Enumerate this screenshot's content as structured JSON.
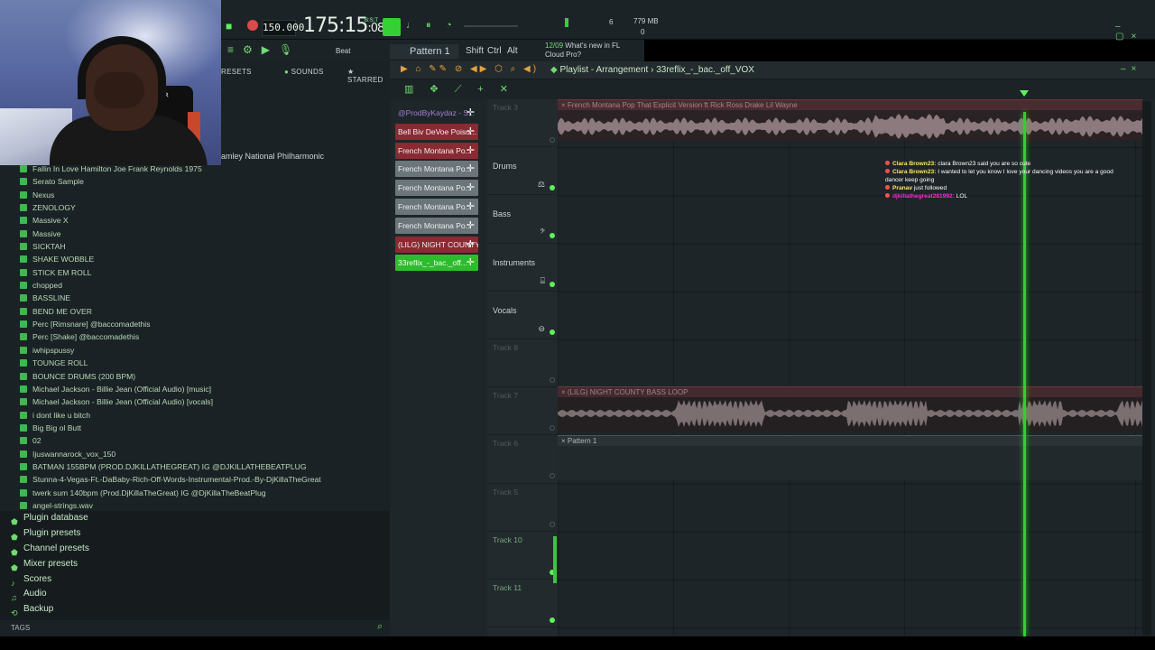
{
  "toolbar": {
    "tempo": "150.000",
    "time": "175:15",
    "time_small": ":08",
    "time_sup": "B:S:T",
    "cpu_num": "6",
    "ram": "779 MB",
    "poly": "0",
    "pattern": "Pattern 1",
    "shift": "Shift",
    "ctrl": "Ctrl",
    "alt": "Alt",
    "beat": "Beat",
    "news_date": "12/09",
    "news_text": "What's new in FL",
    "news_text2": "Cloud Pro?"
  },
  "webcam": {
    "chair_logo": "BOSS R"
  },
  "browser": {
    "tabs": [
      "RESETS",
      "SOUNDS",
      "STARRED"
    ],
    "header_item": "amley National Philharmonic",
    "items": [
      "Fallin In Love  Hamilton Joe Frank  Reynolds  1975",
      "Serato Sample",
      "Nexus",
      "ZENOLOGY",
      "Massive X",
      "Massive",
      "SICKTAH",
      "SHAKE WOBBLE",
      "STICK EM ROLL",
      "chopped",
      "BASSLINE",
      "BEND ME OVER",
      "Perc [Rimsnare] @baccomadethis",
      "Perc [Shake] @baccomadethis",
      "iwhipspussy",
      "TOUNGE ROLL",
      "BOUNCE DRUMS (200 BPM)",
      "Michael Jackson - Billie Jean (Official Audio) [music]",
      "Michael Jackson - Billie Jean (Official Audio) [vocals]",
      "i dont like u bitch",
      "Big Big ol Butt",
      "02",
      "Ijuswannarock_vox_150",
      "BATMAN 155BPM (PROD.DJKILLATHEGREAT) IG @DJKILLATHEBEATPLUG",
      "Stunna-4-Vegas-Ft.-DaBaby-Rich-Off-Words-Instrumental-Prod.-By-DjKillaTheGreat",
      "twerk sum 140bpm (Prod.DjKillaTheGreat) IG @DjKillaTheBeatPlug",
      "angel-strings.wav"
    ],
    "folders": [
      {
        "label": "Plugin database",
        "icon": "plug-icon"
      },
      {
        "label": "Plugin presets",
        "icon": "plug-icon"
      },
      {
        "label": "Channel presets",
        "icon": "plug-icon"
      },
      {
        "label": "Mixer presets",
        "icon": "plug-icon"
      },
      {
        "label": "Scores",
        "icon": "note-icon"
      },
      {
        "label": "Audio",
        "icon": "audio-icon"
      },
      {
        "label": "Backup",
        "icon": "backup-icon"
      }
    ],
    "tags_label": "TAGS"
  },
  "playlist": {
    "title": "Playlist - Arrangement",
    "title_sep": "›",
    "file": "33reflix_-_bac._off_VOX",
    "picker": [
      {
        "label": "@ProdByKaydaz - S...",
        "style": "header"
      },
      {
        "label": "Bell Biv DeVoe  Poiso...",
        "style": "red"
      },
      {
        "label": "French Montana  Po...",
        "style": "red"
      },
      {
        "label": "French Montana  Po...",
        "style": "gray"
      },
      {
        "label": "French Montana  Po...",
        "style": "gray"
      },
      {
        "label": "French Montana  Po...",
        "style": "gray"
      },
      {
        "label": "French Montana  Po...",
        "style": "gray"
      },
      {
        "label": "(LILG) NIGHT COUNTY...",
        "style": "red"
      },
      {
        "label": "33reflix_-_bac._off...",
        "style": "green"
      }
    ],
    "tracks": [
      {
        "name": "Track 3",
        "style": "dim"
      },
      {
        "name": "Drums",
        "style": "big"
      },
      {
        "name": "Bass",
        "style": "big"
      },
      {
        "name": "Instruments",
        "style": "big"
      },
      {
        "name": "Vocals",
        "style": "big"
      },
      {
        "name": "Track 8",
        "style": "dim"
      },
      {
        "name": "Track 7",
        "style": "dim"
      },
      {
        "name": "Track 6",
        "style": "dim"
      },
      {
        "name": "Track 5",
        "style": "dim"
      },
      {
        "name": "Track 10",
        "style": "greenish"
      },
      {
        "name": "Track 11",
        "style": "greenish"
      }
    ],
    "clips": {
      "french_montana": "French Montana  Pop That Explicit Version ft Rick Ross Drake Lil Wayne",
      "lilg": "(LILG) NIGHT COUNTY BASS LOOP",
      "pattern": "Pattern 1"
    },
    "playhead_position": 0.797
  },
  "chat": [
    {
      "user": "Clara Brown23:",
      "text": " clara Brown23 said you are so cute",
      "style": "yellow"
    },
    {
      "user": "Clara Brown23:",
      "text": " I wanted to let you know I love your dancing videos you are a good",
      "style": "yellow"
    },
    {
      "user": "",
      "text": "dancer keep going",
      "style": "plain"
    },
    {
      "user": "Pranav",
      "text": " just followed",
      "style": "yellow"
    },
    {
      "user": "djkillathegreat281992:",
      "text": " LOL",
      "style": "pink"
    }
  ],
  "colors": {
    "accent": "#35d035",
    "playhead": "#2fd02f",
    "clip_red": "#8a2a33"
  }
}
